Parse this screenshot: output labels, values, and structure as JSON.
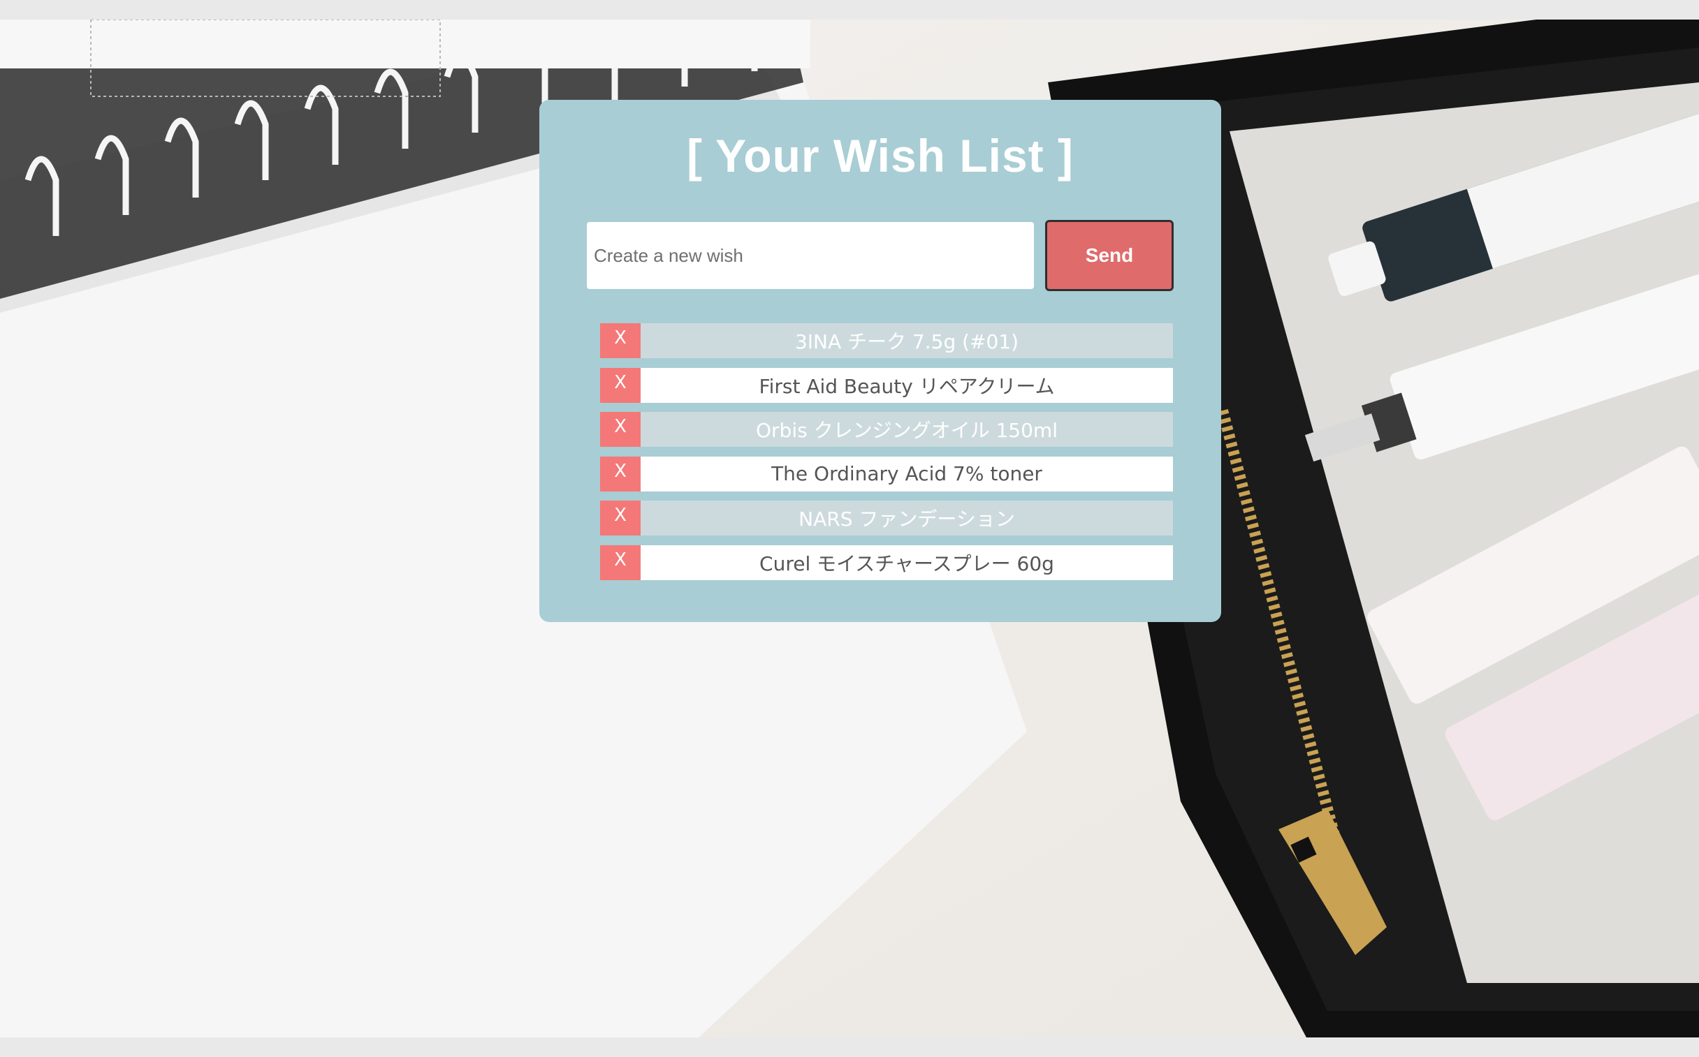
{
  "app": {
    "title": "[ Your Wish List ]"
  },
  "form": {
    "input_value": "",
    "input_placeholder": "Create a new wish",
    "send_label": "Send"
  },
  "wishes": [
    {
      "delete_label": "X",
      "text": "3INA チーク 7.5g (#01)"
    },
    {
      "delete_label": "X",
      "text": "First Aid Beauty リペアクリーム"
    },
    {
      "delete_label": "X",
      "text": "Orbis クレンジングオイル 150ml"
    },
    {
      "delete_label": "X",
      "text": "The Ordinary Acid 7% toner"
    },
    {
      "delete_label": "X",
      "text": "NARS ファンデーション"
    },
    {
      "delete_label": "X",
      "text": "Curel モイスチャースプレー 60g"
    }
  ],
  "colors": {
    "card": "#a8cdd4",
    "send_button": "#e06b6b",
    "delete_button": "#f47878",
    "row_alt": "#cddadd",
    "row_plain": "#ffffff"
  }
}
